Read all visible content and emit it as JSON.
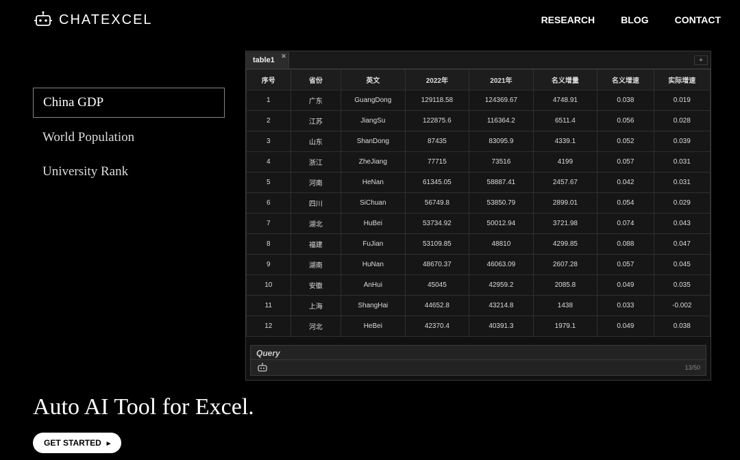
{
  "brand": "CHATEXCEL",
  "nav": {
    "research": "RESEARCH",
    "blog": "BLOG",
    "contact": "CONTACT"
  },
  "sidebar": {
    "items": [
      {
        "label": "China GDP",
        "active": true
      },
      {
        "label": "World Population",
        "active": false
      },
      {
        "label": "University Rank",
        "active": false
      }
    ]
  },
  "tabs": {
    "active": "table1"
  },
  "table": {
    "headers": [
      "序号",
      "省份",
      "英文",
      "2022年",
      "2021年",
      "名义增量",
      "名义增速",
      "实际增速"
    ],
    "rows": [
      [
        "1",
        "广东",
        "GuangDong",
        "129118.58",
        "124369.67",
        "4748.91",
        "0.038",
        "0.019"
      ],
      [
        "2",
        "江苏",
        "JiangSu",
        "122875.6",
        "116364.2",
        "6511.4",
        "0.056",
        "0.028"
      ],
      [
        "3",
        "山东",
        "ShanDong",
        "87435",
        "83095.9",
        "4339.1",
        "0.052",
        "0.039"
      ],
      [
        "4",
        "浙江",
        "ZheJiang",
        "77715",
        "73516",
        "4199",
        "0.057",
        "0.031"
      ],
      [
        "5",
        "河南",
        "HeNan",
        "61345.05",
        "58887.41",
        "2457.67",
        "0.042",
        "0.031"
      ],
      [
        "6",
        "四川",
        "SiChuan",
        "56749.8",
        "53850.79",
        "2899.01",
        "0.054",
        "0.029"
      ],
      [
        "7",
        "湖北",
        "HuBei",
        "53734.92",
        "50012.94",
        "3721.98",
        "0.074",
        "0.043"
      ],
      [
        "8",
        "福建",
        "FuJian",
        "53109.85",
        "48810",
        "4299.85",
        "0.088",
        "0.047"
      ],
      [
        "9",
        "湖南",
        "HuNan",
        "48670.37",
        "46063.09",
        "2607.28",
        "0.057",
        "0.045"
      ],
      [
        "10",
        "安徽",
        "AnHui",
        "45045",
        "42959.2",
        "2085.8",
        "0.049",
        "0.035"
      ],
      [
        "11",
        "上海",
        "ShangHai",
        "44652.8",
        "43214.8",
        "1438",
        "0.033",
        "-0.002"
      ],
      [
        "12",
        "河北",
        "HeBei",
        "42370.4",
        "40391.3",
        "1979.1",
        "0.049",
        "0.038"
      ]
    ]
  },
  "query": {
    "title": "Query",
    "counter": "13/50"
  },
  "hero": {
    "title": "Auto AI Tool for Excel.",
    "cta": "GET STARTED"
  },
  "chart_data": {
    "type": "table",
    "title": "China GDP",
    "columns": [
      "序号",
      "省份",
      "英文",
      "2022年",
      "2021年",
      "名义增量",
      "名义增速",
      "实际增速"
    ],
    "rows": [
      [
        1,
        "广东",
        "GuangDong",
        129118.58,
        124369.67,
        4748.91,
        0.038,
        0.019
      ],
      [
        2,
        "江苏",
        "JiangSu",
        122875.6,
        116364.2,
        6511.4,
        0.056,
        0.028
      ],
      [
        3,
        "山东",
        "ShanDong",
        87435,
        83095.9,
        4339.1,
        0.052,
        0.039
      ],
      [
        4,
        "浙江",
        "ZheJiang",
        77715,
        73516,
        4199,
        0.057,
        0.031
      ],
      [
        5,
        "河南",
        "HeNan",
        61345.05,
        58887.41,
        2457.67,
        0.042,
        0.031
      ],
      [
        6,
        "四川",
        "SiChuan",
        56749.8,
        53850.79,
        2899.01,
        0.054,
        0.029
      ],
      [
        7,
        "湖北",
        "HuBei",
        53734.92,
        50012.94,
        3721.98,
        0.074,
        0.043
      ],
      [
        8,
        "福建",
        "FuJian",
        53109.85,
        48810,
        4299.85,
        0.088,
        0.047
      ],
      [
        9,
        "湖南",
        "HuNan",
        48670.37,
        46063.09,
        2607.28,
        0.057,
        0.045
      ],
      [
        10,
        "安徽",
        "AnHui",
        45045,
        42959.2,
        2085.8,
        0.049,
        0.035
      ],
      [
        11,
        "上海",
        "ShangHai",
        44652.8,
        43214.8,
        1438,
        0.033,
        -0.002
      ],
      [
        12,
        "河北",
        "HeBei",
        42370.4,
        40391.3,
        1979.1,
        0.049,
        0.038
      ]
    ]
  }
}
